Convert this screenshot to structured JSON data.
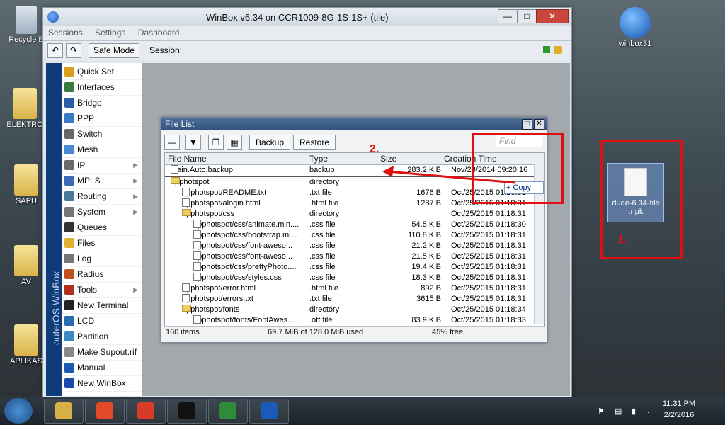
{
  "desktop": {
    "icons_left": [
      {
        "label": "Recycle Bin",
        "display": "Recycle B"
      },
      {
        "label": "ELEKTRONI",
        "display": "ELEKTRO"
      },
      {
        "label": "SAPU",
        "display": "SAPU"
      },
      {
        "label": "AV",
        "display": "AV"
      },
      {
        "label": "APLIKASI",
        "display": "APLIKAS"
      }
    ],
    "winbox31_label": "winbox31",
    "npk_file_label": "dude-6.34-tile\n.npk"
  },
  "winbox": {
    "title": "WinBox v6.34 on CCR1009-8G-1S-1S+ (tile)",
    "menu": [
      "Sessions",
      "Settings",
      "Dashboard"
    ],
    "toolbar": {
      "safe_mode": "Safe Mode",
      "session_label": "Session:"
    },
    "sidebar_brand": "outerOS WinBox",
    "sidebar_items": [
      {
        "label": "Quick Set",
        "icon": "wand-icon",
        "arrow": false
      },
      {
        "label": "Interfaces",
        "icon": "interfaces-icon",
        "arrow": false
      },
      {
        "label": "Bridge",
        "icon": "bridge-icon",
        "arrow": false
      },
      {
        "label": "PPP",
        "icon": "ppp-icon",
        "arrow": false
      },
      {
        "label": "Switch",
        "icon": "switch-icon",
        "arrow": false
      },
      {
        "label": "Mesh",
        "icon": "mesh-icon",
        "arrow": false
      },
      {
        "label": "IP",
        "icon": "ip-icon",
        "arrow": true
      },
      {
        "label": "MPLS",
        "icon": "mpls-icon",
        "arrow": true
      },
      {
        "label": "Routing",
        "icon": "routing-icon",
        "arrow": true
      },
      {
        "label": "System",
        "icon": "gear-icon",
        "arrow": true
      },
      {
        "label": "Queues",
        "icon": "queues-icon",
        "arrow": false
      },
      {
        "label": "Files",
        "icon": "folder-icon",
        "arrow": false
      },
      {
        "label": "Log",
        "icon": "log-icon",
        "arrow": false
      },
      {
        "label": "Radius",
        "icon": "radius-icon",
        "arrow": false
      },
      {
        "label": "Tools",
        "icon": "tools-icon",
        "arrow": true
      },
      {
        "label": "New Terminal",
        "icon": "terminal-icon",
        "arrow": false
      },
      {
        "label": "LCD",
        "icon": "lcd-icon",
        "arrow": false
      },
      {
        "label": "Partition",
        "icon": "partition-icon",
        "arrow": false
      },
      {
        "label": "Make Supout.rif",
        "icon": "supout-icon",
        "arrow": false
      },
      {
        "label": "Manual",
        "icon": "help-icon",
        "arrow": false
      },
      {
        "label": "New WinBox",
        "icon": "winbox-icon",
        "arrow": false
      }
    ]
  },
  "file_list": {
    "title": "File List",
    "buttons": {
      "backup": "Backup",
      "restore": "Restore"
    },
    "find_placeholder": "Find",
    "columns": [
      "File Name",
      "Type",
      "Size",
      "Creation Time"
    ],
    "rows": [
      {
        "name": "Main.Auto.backup",
        "type": "backup",
        "size": "283.2 KiB",
        "date": "Nov/28/2014 09:20:16",
        "kind": "file",
        "indent": 0
      },
      {
        "name": "apphotspot",
        "type": "directory",
        "size": "",
        "date": "",
        "kind": "dir",
        "indent": 0
      },
      {
        "name": "apphotspot/README.txt",
        "type": ".txt file",
        "size": "1676 B",
        "date": "Oct/25/2015 01:18:31",
        "kind": "file",
        "indent": 1
      },
      {
        "name": "apphotspot/alogin.html",
        "type": ".html file",
        "size": "1287 B",
        "date": "Oct/25/2015 01:18:31",
        "kind": "file",
        "indent": 1
      },
      {
        "name": "apphotspot/css",
        "type": "directory",
        "size": "",
        "date": "Oct/25/2015 01:18:31",
        "kind": "dir",
        "indent": 1
      },
      {
        "name": "apphotspot/css/animate.min....",
        "type": ".css file",
        "size": "54.5 KiB",
        "date": "Oct/25/2015 01:18:30",
        "kind": "file",
        "indent": 2
      },
      {
        "name": "apphotspot/css/bootstrap.mi...",
        "type": ".css file",
        "size": "110.8 KiB",
        "date": "Oct/25/2015 01:18:31",
        "kind": "file",
        "indent": 2
      },
      {
        "name": "apphotspot/css/font-aweso...",
        "type": ".css file",
        "size": "21.2 KiB",
        "date": "Oct/25/2015 01:18:31",
        "kind": "file",
        "indent": 2
      },
      {
        "name": "apphotspot/css/font-aweso...",
        "type": ".css file",
        "size": "21.5 KiB",
        "date": "Oct/25/2015 01:18:31",
        "kind": "file",
        "indent": 2
      },
      {
        "name": "apphotspot/css/prettyPhoto....",
        "type": ".css file",
        "size": "19.4 KiB",
        "date": "Oct/25/2015 01:18:31",
        "kind": "file",
        "indent": 2
      },
      {
        "name": "apphotspot/css/styles.css",
        "type": ".css file",
        "size": "18.3 KiB",
        "date": "Oct/25/2015 01:18:31",
        "kind": "file",
        "indent": 2
      },
      {
        "name": "apphotspot/error.html",
        "type": ".html file",
        "size": "892 B",
        "date": "Oct/25/2015 01:18:31",
        "kind": "file",
        "indent": 1
      },
      {
        "name": "apphotspot/errors.txt",
        "type": ".txt file",
        "size": "3615 B",
        "date": "Oct/25/2015 01:18:31",
        "kind": "file",
        "indent": 1
      },
      {
        "name": "apphotspot/fonts",
        "type": "directory",
        "size": "",
        "date": "Oct/25/2015 01:18:34",
        "kind": "dir",
        "indent": 1
      },
      {
        "name": "apphotspot/fonts/FontAwes...",
        "type": ".otf file",
        "size": "83.9 KiB",
        "date": "Oct/25/2015 01:18:33",
        "kind": "file",
        "indent": 2
      }
    ],
    "status": {
      "items": "160 items",
      "usage": "69.7 MiB of 128.0 MiB used",
      "free": "45% free"
    },
    "copy_hint": "+ Copy"
  },
  "annotations": {
    "label1": "1.",
    "label2": "2."
  },
  "taskbar": {
    "apps": [
      "file-explorer-icon",
      "apps-icon",
      "chrome-icon",
      "cmd-icon",
      "excel-icon",
      "winbox-icon"
    ],
    "time": "11:31 PM",
    "date": "2/2/2016"
  }
}
